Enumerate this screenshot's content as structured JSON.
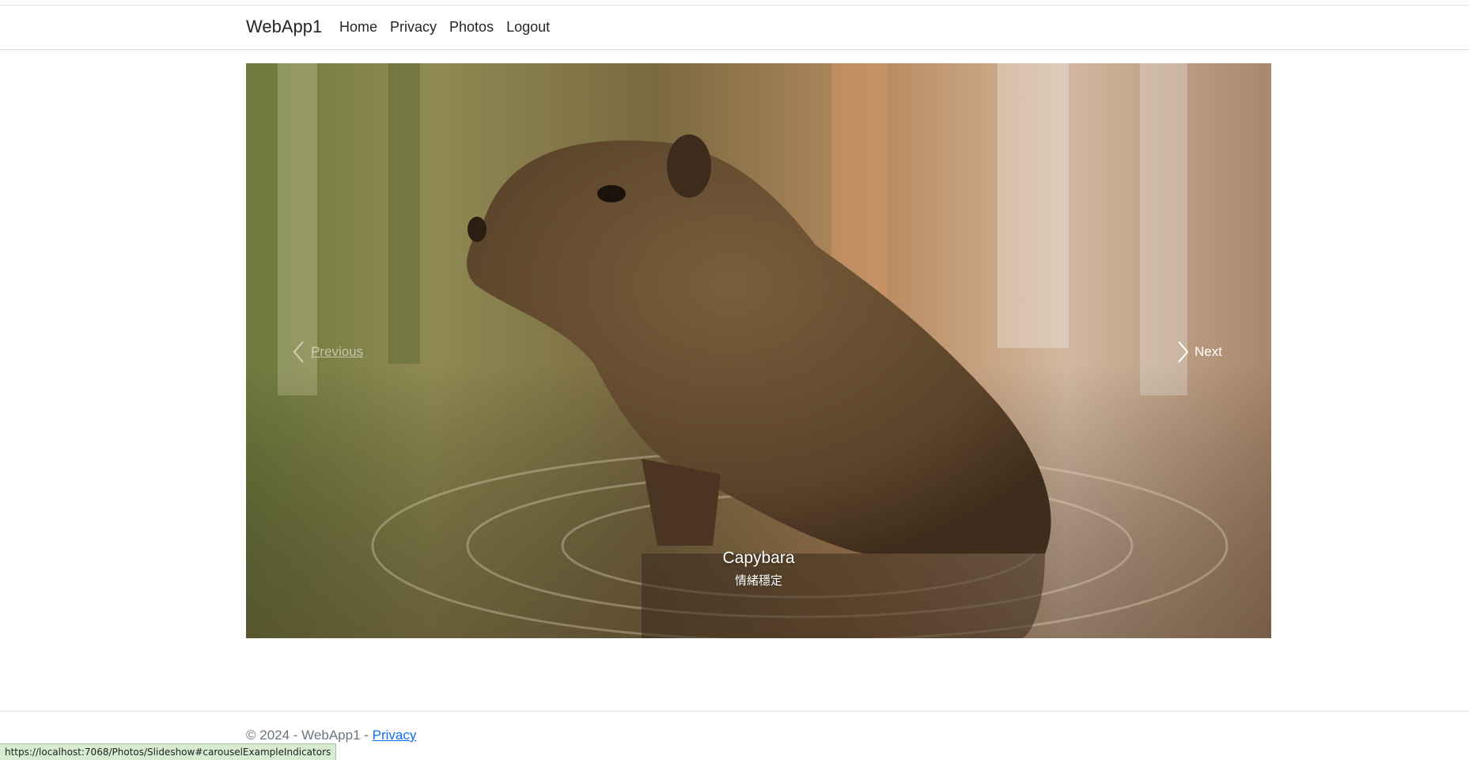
{
  "navbar": {
    "brand": "WebApp1",
    "links": [
      "Home",
      "Privacy",
      "Photos",
      "Logout"
    ]
  },
  "carousel": {
    "prev_label": "Previous",
    "next_label": "Next",
    "caption_title": "Capybara",
    "caption_text": "情緒穩定",
    "image_subject": "capybara standing in water"
  },
  "footer": {
    "copyright": "© 2024 - WebApp1 - ",
    "privacy_link": "Privacy"
  },
  "status_bar": {
    "url": "https://localhost:7068/Photos/Slideshow#carouselExampleIndicators"
  },
  "colors": {
    "link": "#0d6efd",
    "footer_text": "#6c757d",
    "status_bg": "#d7ecd1"
  }
}
